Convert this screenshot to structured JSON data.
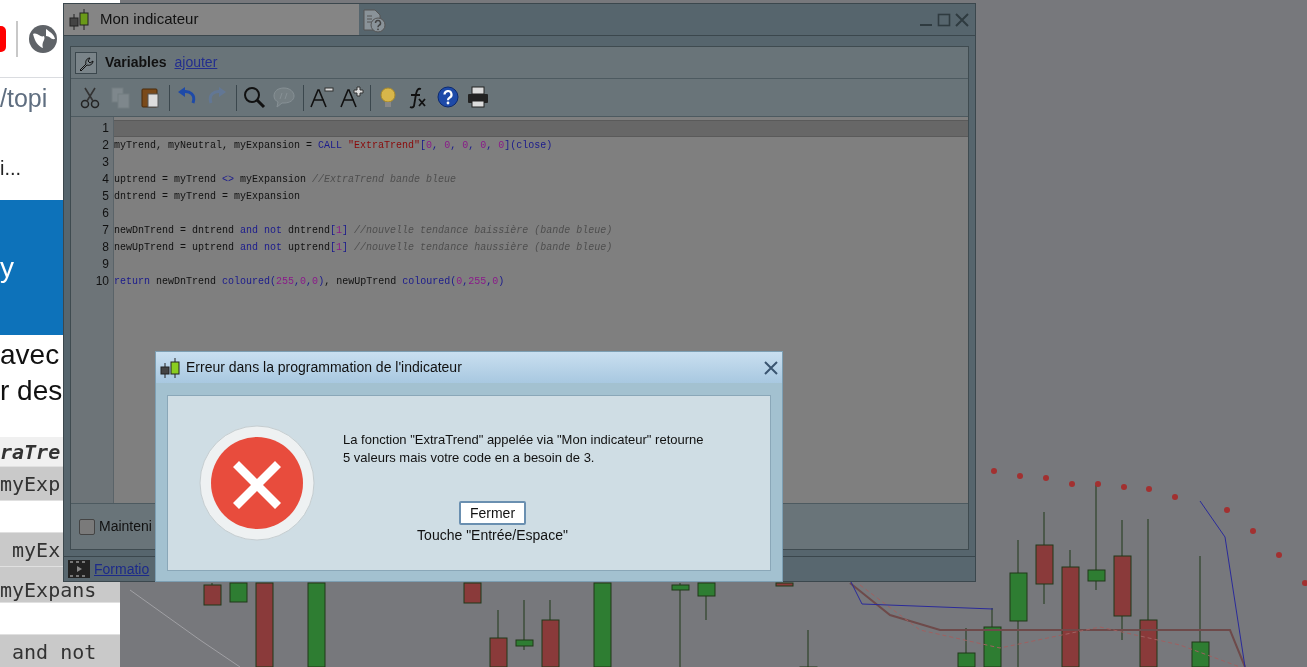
{
  "browser_page": {
    "address": "/topi",
    "tab_text": "i...",
    "banner_text": "y",
    "paragraph": [
      "avec",
      "r des"
    ],
    "code_lines": [
      {
        "text": "raTre",
        "kind": "heading"
      },
      {
        "text": "myExp",
        "kind": "code"
      },
      {
        "kind": "blank"
      },
      {
        "text": " myEx",
        "kind": "code"
      },
      {
        "text": "myExpans",
        "kind": "code-low"
      },
      {
        "kind": "blank"
      },
      {
        "text": " and not",
        "kind": "code"
      }
    ]
  },
  "editor_window": {
    "title": "Mon indicateur",
    "variables_label": "Variables",
    "add_link": "ajouter",
    "tools": [
      {
        "kind": "cut",
        "disabled": false
      },
      {
        "kind": "copy",
        "disabled": true
      },
      {
        "kind": "paste",
        "disabled": false
      },
      {
        "kind": "separator"
      },
      {
        "kind": "undo",
        "disabled": false
      },
      {
        "kind": "redo",
        "disabled": true
      },
      {
        "kind": "separator"
      },
      {
        "kind": "search",
        "disabled": false
      },
      {
        "kind": "comment",
        "disabled": true
      },
      {
        "kind": "separator"
      },
      {
        "kind": "font-smaller",
        "disabled": false
      },
      {
        "kind": "font-larger",
        "disabled": false
      },
      {
        "kind": "separator"
      },
      {
        "kind": "bulb",
        "disabled": false
      },
      {
        "kind": "function",
        "disabled": false
      },
      {
        "kind": "help",
        "disabled": false
      },
      {
        "kind": "print",
        "disabled": false
      }
    ],
    "code": [
      {
        "number": "1",
        "selected": true
      },
      {
        "number": "2",
        "selected": false,
        "tokens": [
          {
            "kind": "text",
            "text": "myTrend, myNeutral, myExpansion = "
          },
          {
            "kind": "keyword",
            "text": "CALL "
          },
          {
            "kind": "string",
            "text": "\"ExtraTrend\""
          },
          {
            "kind": "keyword",
            "text": "["
          },
          {
            "kind": "number",
            "text": "0"
          },
          {
            "kind": "keyword",
            "text": ", "
          },
          {
            "kind": "number",
            "text": "0"
          },
          {
            "kind": "keyword",
            "text": ", "
          },
          {
            "kind": "number",
            "text": "0"
          },
          {
            "kind": "keyword",
            "text": ", "
          },
          {
            "kind": "number",
            "text": "0"
          },
          {
            "kind": "keyword",
            "text": ", "
          },
          {
            "kind": "number",
            "text": "0"
          },
          {
            "kind": "keyword",
            "text": "](close)"
          }
        ]
      },
      {
        "number": "3",
        "selected": false
      },
      {
        "number": "4",
        "selected": false,
        "tokens": [
          {
            "kind": "text",
            "text": "uptrend = myTrend "
          },
          {
            "kind": "keyword",
            "text": "<>"
          },
          {
            "kind": "text",
            "text": " myExpansion "
          },
          {
            "kind": "comment",
            "text": "//ExtraTrend bande bleue"
          }
        ]
      },
      {
        "number": "5",
        "selected": false,
        "tokens": [
          {
            "kind": "text",
            "text": "dntrend = myTrend = myExpansion"
          }
        ]
      },
      {
        "number": "6",
        "selected": false
      },
      {
        "number": "7",
        "selected": false,
        "tokens": [
          {
            "kind": "text",
            "text": "newDnTrend = dntrend "
          },
          {
            "kind": "keyword",
            "text": "and not"
          },
          {
            "kind": "text",
            "text": " dntrend"
          },
          {
            "kind": "keyword",
            "text": "["
          },
          {
            "kind": "number",
            "text": "1"
          },
          {
            "kind": "keyword",
            "text": "] "
          },
          {
            "kind": "comment",
            "text": "//nouvelle tendance baissière (bande bleue)"
          }
        ]
      },
      {
        "number": "8",
        "selected": false,
        "tokens": [
          {
            "kind": "text",
            "text": "newUpTrend = uptrend "
          },
          {
            "kind": "keyword",
            "text": "and not"
          },
          {
            "kind": "text",
            "text": " uptrend"
          },
          {
            "kind": "keyword",
            "text": "["
          },
          {
            "kind": "number",
            "text": "1"
          },
          {
            "kind": "keyword",
            "text": "] "
          },
          {
            "kind": "comment",
            "text": "//nouvelle tendance haussière (bande bleue)"
          }
        ]
      },
      {
        "number": "9",
        "selected": false
      },
      {
        "number": "10",
        "selected": false,
        "tokens": [
          {
            "kind": "keyword",
            "text": "return"
          },
          {
            "kind": "text",
            "text": " newDnTrend "
          },
          {
            "kind": "keyword",
            "text": "coloured("
          },
          {
            "kind": "number",
            "text": "255"
          },
          {
            "kind": "keyword",
            "text": ","
          },
          {
            "kind": "number",
            "text": "0"
          },
          {
            "kind": "keyword",
            "text": ","
          },
          {
            "kind": "number",
            "text": "0"
          },
          {
            "kind": "keyword",
            "text": ")"
          },
          {
            "kind": "text",
            "text": ", newUpTrend "
          },
          {
            "kind": "keyword",
            "text": "coloured("
          },
          {
            "kind": "number",
            "text": "0"
          },
          {
            "kind": "keyword",
            "text": ","
          },
          {
            "kind": "number",
            "text": "255"
          },
          {
            "kind": "keyword",
            "text": ","
          },
          {
            "kind": "number",
            "text": "0"
          },
          {
            "kind": "keyword",
            "text": ")"
          }
        ]
      }
    ],
    "keep_option": {
      "label": "Mainteni",
      "checked": false
    },
    "footer_link": "Formatio"
  },
  "error_dialog": {
    "title": "Erreur dans la programmation de l'indicateur",
    "message": [
      "La fonction \"ExtraTrend\" appelée via \"Mon indicateur\" retourne",
      "5 valeurs mais votre code en a besoin de 3."
    ],
    "button": "Fermer",
    "hint": "Touche \"Entrée/Espace\""
  }
}
